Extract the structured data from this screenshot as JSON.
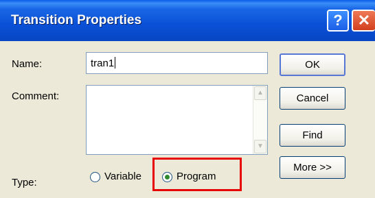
{
  "window": {
    "title": "Transition Properties",
    "help_label": "?",
    "close_label": "✕"
  },
  "form": {
    "name_label": "Name:",
    "name_value": "tran1",
    "comment_label": "Comment:",
    "comment_value": "",
    "type_label": "Type:",
    "type_options": [
      {
        "label": "Variable",
        "selected": false
      },
      {
        "label": "Program",
        "selected": true
      }
    ]
  },
  "buttons": {
    "ok": "OK",
    "cancel": "Cancel",
    "find": "Find",
    "more": "More >>"
  },
  "icons": {
    "scroll_up": "▲",
    "scroll_down": "▼"
  },
  "colors": {
    "titlebar": "#0a50d6",
    "highlight": "#e60000",
    "radio_selected": "#2f8a2f"
  }
}
